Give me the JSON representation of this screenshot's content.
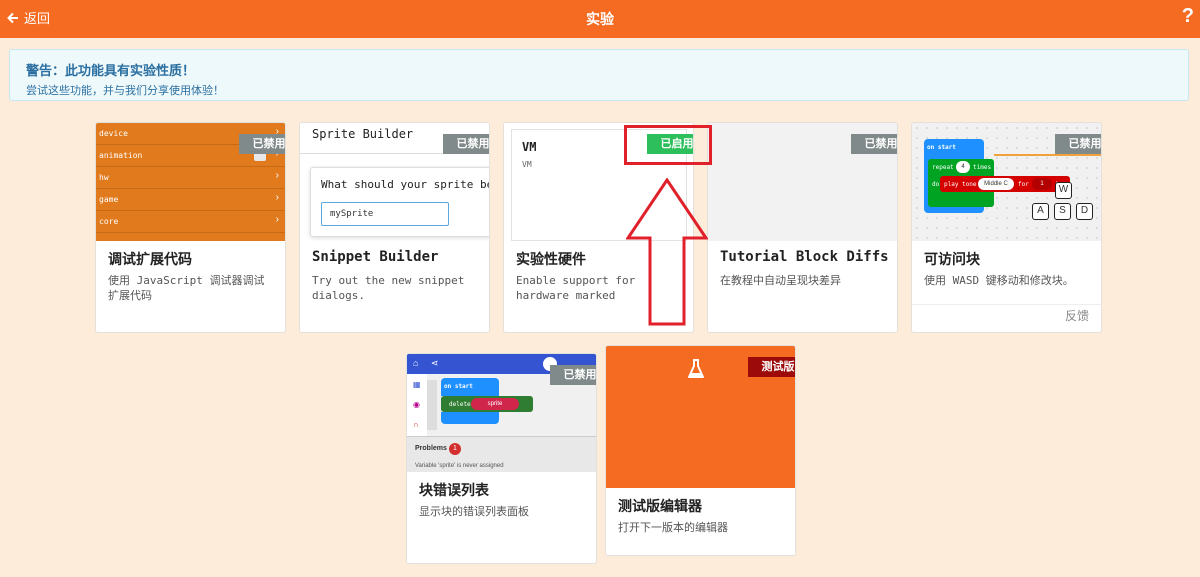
{
  "header": {
    "back_label": "返回",
    "title": "实验",
    "help_label": "?"
  },
  "warning": {
    "title": "警告：此功能具有实验性质！",
    "text": "尝试这些功能，并与我们分享使用体验！"
  },
  "cards": [
    {
      "title": "调试扩展代码",
      "desc": "使用 JavaScript 调试器调试扩展代码",
      "badge": "已禁用",
      "thumb_items": [
        "device",
        "animation",
        "hw",
        "game",
        "core"
      ]
    },
    {
      "title": "Snippet Builder",
      "desc": "Try out the new snippet dialogs.",
      "badge": "已禁用",
      "thumb_title": "Sprite Builder",
      "thumb_question": "What should your sprite be",
      "thumb_input": "mySprite"
    },
    {
      "title": "实验性硬件",
      "desc": "Enable support for hardware marked 'experimental' in the",
      "badge": "已启用",
      "thumb_title": "VM",
      "thumb_sub": "VM"
    },
    {
      "title": "Tutorial Block Diffs",
      "desc": "在教程中自动呈现块差异",
      "badge": "已禁用"
    },
    {
      "title": "可访问块",
      "desc": "使用 WASD 键移动和修改块。",
      "badge": "已禁用",
      "feedback": "反馈",
      "thumb_blocks": {
        "on_start": "on start",
        "repeat": "repeat",
        "times_n": "4",
        "times": "times",
        "do": "do",
        "play": "play tone",
        "note": "Middle C",
        "for": "for",
        "beats_n": "1",
        "beats": "b"
      },
      "keys": [
        "W",
        "A",
        "S",
        "D"
      ]
    },
    {
      "title": "块错误列表",
      "desc": "显示块的错误列表面板",
      "badge": "已禁用",
      "thumb": {
        "on_start": "on start",
        "delete": "delete",
        "sprite": "sprite",
        "problems": "Problems",
        "count": "1",
        "message": "Variable 'sprite' is never assigned"
      }
    },
    {
      "title": "测试版编辑器",
      "desc": "打开下一版本的编辑器",
      "badge": "测试版"
    }
  ],
  "colors": {
    "accent": "#f56b22",
    "enabled": "#2dbf5b",
    "disabled": "#808a8a",
    "beta": "#9d0a0a",
    "highlight": "#e0202a"
  }
}
